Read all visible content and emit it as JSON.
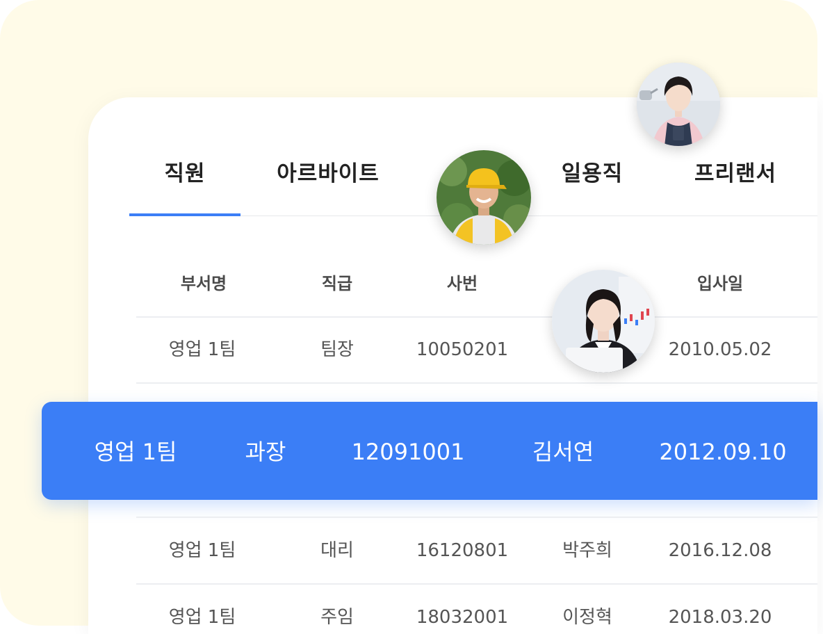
{
  "tabs": [
    {
      "label": "직원",
      "active": true
    },
    {
      "label": "아르바이트",
      "active": false
    },
    {
      "label": "일용직",
      "active": false
    },
    {
      "label": "프리랜서",
      "active": false
    }
  ],
  "table": {
    "headers": [
      "부서명",
      "직급",
      "사번",
      "입사일"
    ],
    "rows": [
      {
        "dept": "영업 1팀",
        "rank": "팀장",
        "id": "10050201",
        "name": "",
        "date": "2010.05.02"
      },
      {
        "dept": "영업 1팀",
        "rank": "과장",
        "id": "12091001",
        "name": "김서연",
        "date": "2012.09.10",
        "selected": true
      },
      {
        "dept": "영업 1팀",
        "rank": "대리",
        "id": "16120801",
        "name": "박주희",
        "date": "2016.12.08"
      },
      {
        "dept": "영업 1팀",
        "rank": "주임",
        "id": "18032001",
        "name": "이정혁",
        "date": "2018.03.20"
      }
    ]
  },
  "avatars": [
    {
      "icon": "barista-avatar-icon"
    },
    {
      "icon": "delivery-worker-avatar-icon"
    },
    {
      "icon": "office-worker-avatar-icon"
    }
  ],
  "colors": {
    "accent": "#3b7ef6",
    "background": "#fffbe8",
    "panel": "#ffffff"
  }
}
